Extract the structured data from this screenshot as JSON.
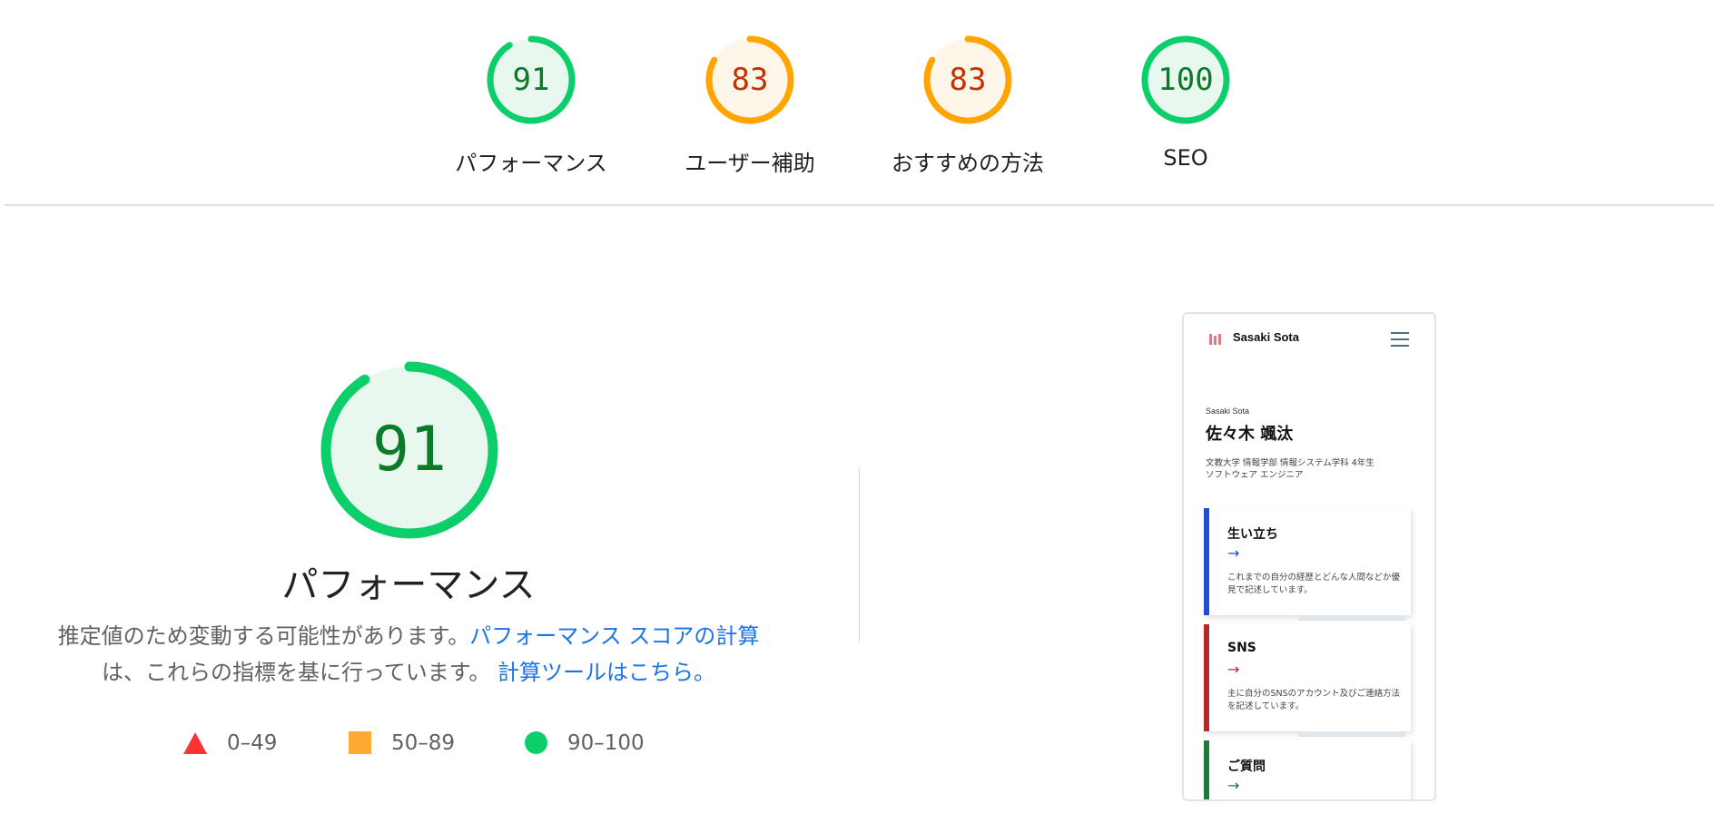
{
  "top_gauges": [
    {
      "score": "91",
      "label": "パフォーマンス",
      "status": "pass"
    },
    {
      "score": "83",
      "label": "ユーザー補助",
      "status": "average"
    },
    {
      "score": "83",
      "label": "おすすめの方法",
      "status": "average"
    },
    {
      "score": "100",
      "label": "SEO",
      "status": "pass"
    }
  ],
  "main": {
    "score": "91",
    "title": "パフォーマンス",
    "desc_part1": "推定値のため変動する可能性があります。",
    "desc_link1": "パフォーマンス スコアの計算",
    "desc_part2": "は、これらの指標を基に行っています。",
    "desc_link2": "計算ツールはこちら。"
  },
  "legend": [
    {
      "symbol": "triangle",
      "range": "0–49",
      "color": "#ff3333"
    },
    {
      "symbol": "square",
      "range": "50–89",
      "color": "#ffaa33"
    },
    {
      "symbol": "circle",
      "range": "90–100",
      "color": "#0cce6b"
    }
  ],
  "colors": {
    "pass_ring": "#0cce6b",
    "pass_fill": "#e8f8ee",
    "pass_text": "#0b7a29",
    "average_ring": "#ffa400",
    "average_fill": "#fff6ea",
    "average_text": "#c33300"
  },
  "phone": {
    "site_name": "Sasaki Sota",
    "menu_icon": "hamburger-icon",
    "subtitle": "Sasaki Sota",
    "name": "佐々木 颯汰",
    "desc_line1": "文教大学 情報学部 情報システム学科 4年生",
    "desc_line2": "ソフトウェア エンジニア",
    "cards": [
      {
        "title": "生い立ち",
        "arrow": "→",
        "text": "これまでの自分の経歴とどんな人間などか優見で記述しています。",
        "accent": "#1f4fcf"
      },
      {
        "title": "SNS",
        "arrow": "→",
        "text": "主に自分のSNSのアカウント及びご連絡方法を記述しています。",
        "accent": "#b22a2a"
      },
      {
        "title": "ご質問",
        "arrow": "→",
        "text": "",
        "accent": "#1e7a3a"
      }
    ]
  }
}
